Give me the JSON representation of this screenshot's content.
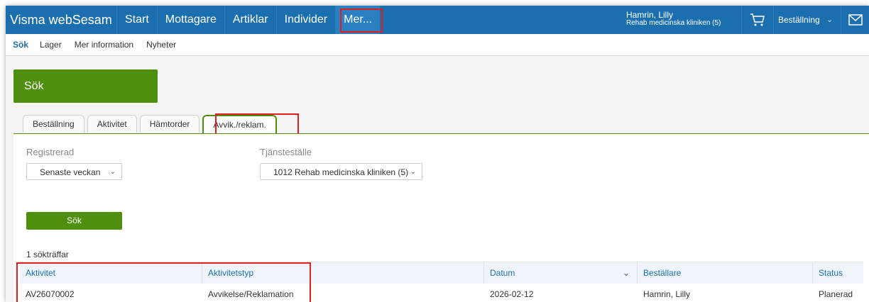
{
  "app": {
    "brand": "Visma webSesam"
  },
  "topnav": {
    "items": [
      {
        "label": "Start"
      },
      {
        "label": "Mottagare"
      },
      {
        "label": "Artiklar"
      },
      {
        "label": "Individer"
      },
      {
        "label": "Mer..."
      }
    ]
  },
  "user": {
    "name": "Hamrin, Lilly",
    "org": "Rehab medicinska kliniken (5)"
  },
  "cart": {
    "icon": "cart-icon"
  },
  "order_menu": {
    "label": "Beställning",
    "icon": "chevron-down-icon"
  },
  "mail": {
    "icon": "mail-icon"
  },
  "subnav": {
    "items": [
      {
        "label": "Sök"
      },
      {
        "label": "Lager"
      },
      {
        "label": "Mer information"
      },
      {
        "label": "Nyheter"
      }
    ]
  },
  "hero": {
    "title": "Sök"
  },
  "tabs": [
    {
      "label": "Beställning"
    },
    {
      "label": "Aktivitet"
    },
    {
      "label": "Hämtorder"
    },
    {
      "label": "Avvik./reklam."
    }
  ],
  "filters": {
    "registered": {
      "label": "Registrerad",
      "value": "Senaste veckan"
    },
    "unit": {
      "label": "Tjänsteställe",
      "value": "1012 Rehab medicinska kliniken (5)"
    }
  },
  "search_button": {
    "label": "Sök"
  },
  "results": {
    "count_text": "1 sökträffar",
    "columns": [
      "Aktivitet",
      "Aktivitetstyp",
      "Datum",
      "Beställare",
      "Status"
    ],
    "rows": [
      [
        "AV26070002",
        "Avvikelse/Reklamation",
        "2026-02-12",
        "Hamrin, Lilly",
        "Planerad"
      ]
    ]
  },
  "colors": {
    "topbar": "#1b6faf",
    "accent_green": "#4f8f0e",
    "highlight": "#e0201f"
  }
}
